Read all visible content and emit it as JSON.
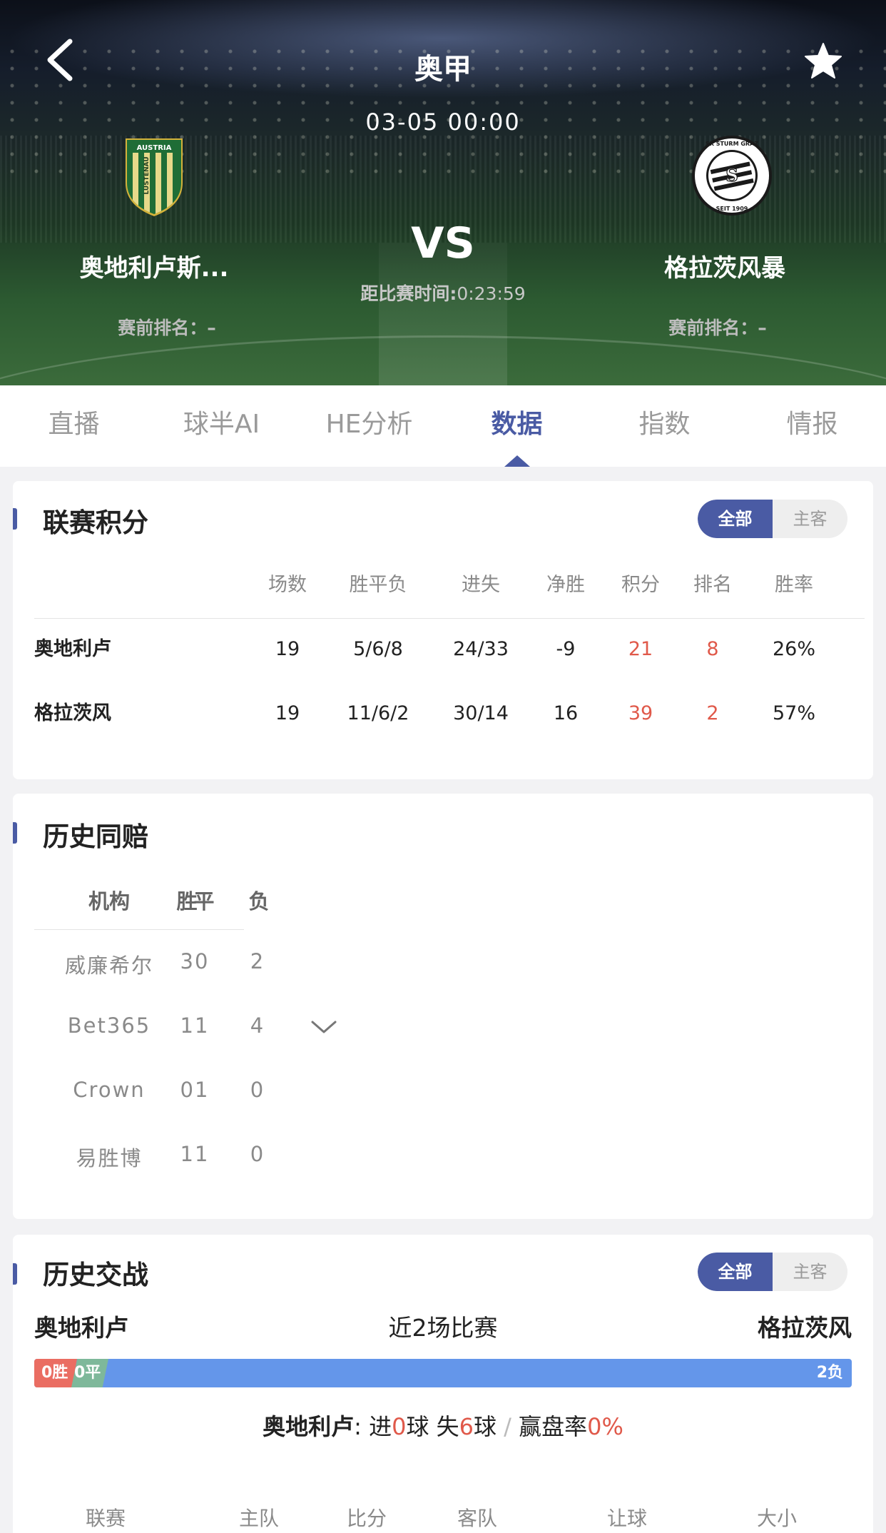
{
  "header": {
    "league": "奥甲",
    "match_time": "03-05 00:00",
    "vs": "VS",
    "countdown_label": "距比赛时间:",
    "countdown_value": "0:23:59",
    "home": {
      "name": "奥地利卢斯...",
      "rank_label": "赛前排名：–"
    },
    "away": {
      "name": "格拉茨风暴",
      "rank_label": "赛前排名：–"
    },
    "home_logo_text_top": "AUSTRIA",
    "home_logo_text_mid": "LUSTENAU",
    "away_logo_text_top": "SK STURM GRAZ",
    "away_logo_text_bottom": "SEIT 1909"
  },
  "tabs": [
    {
      "label": "直播"
    },
    {
      "label": "球半AI"
    },
    {
      "label": "HE分析"
    },
    {
      "label": "数据",
      "active": true
    },
    {
      "label": "指数"
    },
    {
      "label": "情报"
    }
  ],
  "standings": {
    "title": "联赛积分",
    "toggle": {
      "all": "全部",
      "home_away": "主客"
    },
    "columns": [
      "场数",
      "胜平负",
      "进失",
      "净胜",
      "积分",
      "排名",
      "胜率"
    ],
    "rows": [
      {
        "team": "奥地利卢",
        "played": "19",
        "wdl": "5/6/8",
        "goals": "24/33",
        "diff": "-9",
        "points": "21",
        "rank": "8",
        "rate": "26%"
      },
      {
        "team": "格拉茨风",
        "played": "19",
        "wdl": "11/6/2",
        "goals": "30/14",
        "diff": "16",
        "points": "39",
        "rank": "2",
        "rate": "57%"
      }
    ]
  },
  "odds_history": {
    "title": "历史同赔",
    "columns": {
      "agency": "机构",
      "win": "胜",
      "draw": "平",
      "lose": "负"
    },
    "rows": [
      {
        "agency": "威廉希尔",
        "win_draw": "30",
        "lose": "2"
      },
      {
        "agency": "Bet365",
        "win_draw": "11",
        "lose": "4"
      },
      {
        "agency": "Crown",
        "win_draw": "01",
        "lose": "0"
      },
      {
        "agency": "易胜博",
        "win_draw": "11",
        "lose": "0"
      }
    ]
  },
  "h2h": {
    "title": "历史交战",
    "toggle": {
      "all": "全部",
      "home_away": "主客"
    },
    "home": "奥地利卢",
    "away": "格拉茨风",
    "recent": "近2场比赛",
    "win_label": "0胜",
    "draw_label": "0平",
    "lose_label": "2负",
    "summary_team": "奥地利卢",
    "summary_colon": ":",
    "summary_in_pre": "进",
    "goals_for": "0",
    "summary_in_post": "球 失",
    "goals_against": "6",
    "summary_ball": "球",
    "slash": "/",
    "summary_rate_label": "赢盘率",
    "cover_rate": "0%",
    "columns": [
      "联赛",
      "主队",
      "比分",
      "客队",
      "让球",
      "大小"
    ]
  },
  "colors": {
    "accent": "#4a5ba4",
    "red": "#e0594a",
    "win_bar": "#ea6d62",
    "draw_bar": "#7eb89a",
    "lose_bar": "#6496ea"
  }
}
